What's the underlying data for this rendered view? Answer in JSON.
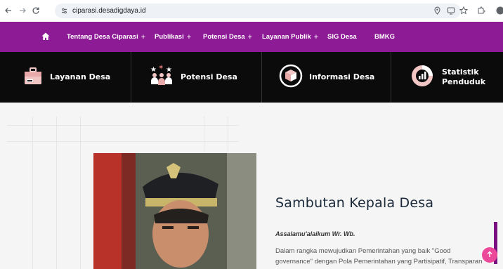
{
  "browser": {
    "url": "ciparasi.desadigdaya.id"
  },
  "topnav": {
    "items": [
      {
        "label": "Tentang Desa Ciparasi",
        "plus": "+"
      },
      {
        "label": "Publikasi",
        "plus": "+"
      },
      {
        "label": "Potensi Desa",
        "plus": "+"
      },
      {
        "label": "Layanan Publik",
        "plus": "+"
      },
      {
        "label": "SIG Desa",
        "plus": ""
      },
      {
        "label": "BMKG",
        "plus": ""
      }
    ],
    "background": "#8e1b96"
  },
  "services": [
    {
      "label": "Layanan Desa",
      "icon": "briefcase-icon"
    },
    {
      "label": "Potensi Desa",
      "icon": "people-stars-icon"
    },
    {
      "label": "Informasi Desa",
      "icon": "box-icon"
    },
    {
      "label": "Statistik Penduduk",
      "icon": "chart-icon"
    }
  ],
  "welcome": {
    "title": "Sambutan Kepala Desa",
    "greeting": "Assalamu'alaikum Wr. Wb.",
    "paragraph_line1": "Dalam rangka mewujudkan Pemerintahan yang baik \"Good",
    "paragraph_line2": "governance\" dengan Pola Pemerintahan yang Partisipatif, Transparan"
  },
  "colors": {
    "accent": "#8e1b96",
    "scroll_button": "#ec4899"
  }
}
